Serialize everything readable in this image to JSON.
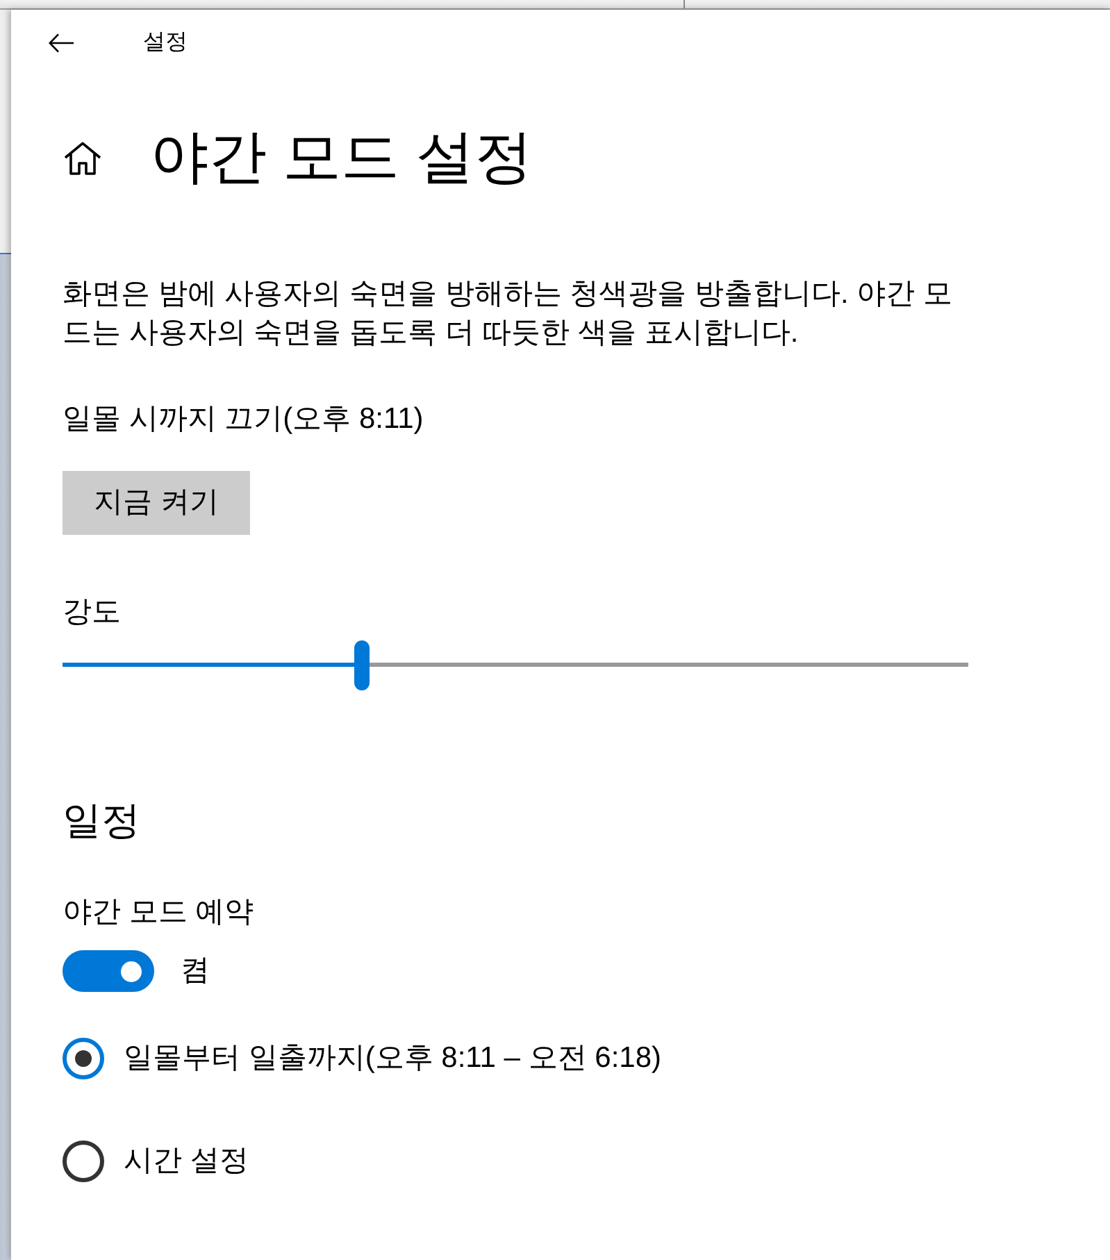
{
  "window": {
    "title": "설정"
  },
  "page": {
    "title": "야간 모드 설정",
    "description": "화면은 밤에 사용자의 숙면을 방해하는 청색광을 방출합니다. 야간 모드는 사용자의 숙면을 돕도록 더 따듯한 색을 표시합니다.",
    "status": "일몰 시까지 끄기(오후 8:11)",
    "action_button": "지금 켜기"
  },
  "strength": {
    "label": "강도",
    "level": 0.33
  },
  "schedule": {
    "heading": "일정",
    "toggle": {
      "label": "야간 모드 예약",
      "on": true,
      "state_text": "켬"
    },
    "options": [
      {
        "label": "일몰부터 일출까지(오후 8:11 – 오전 6:18)",
        "selected": true
      },
      {
        "label": "시간 설정",
        "selected": false
      }
    ]
  }
}
